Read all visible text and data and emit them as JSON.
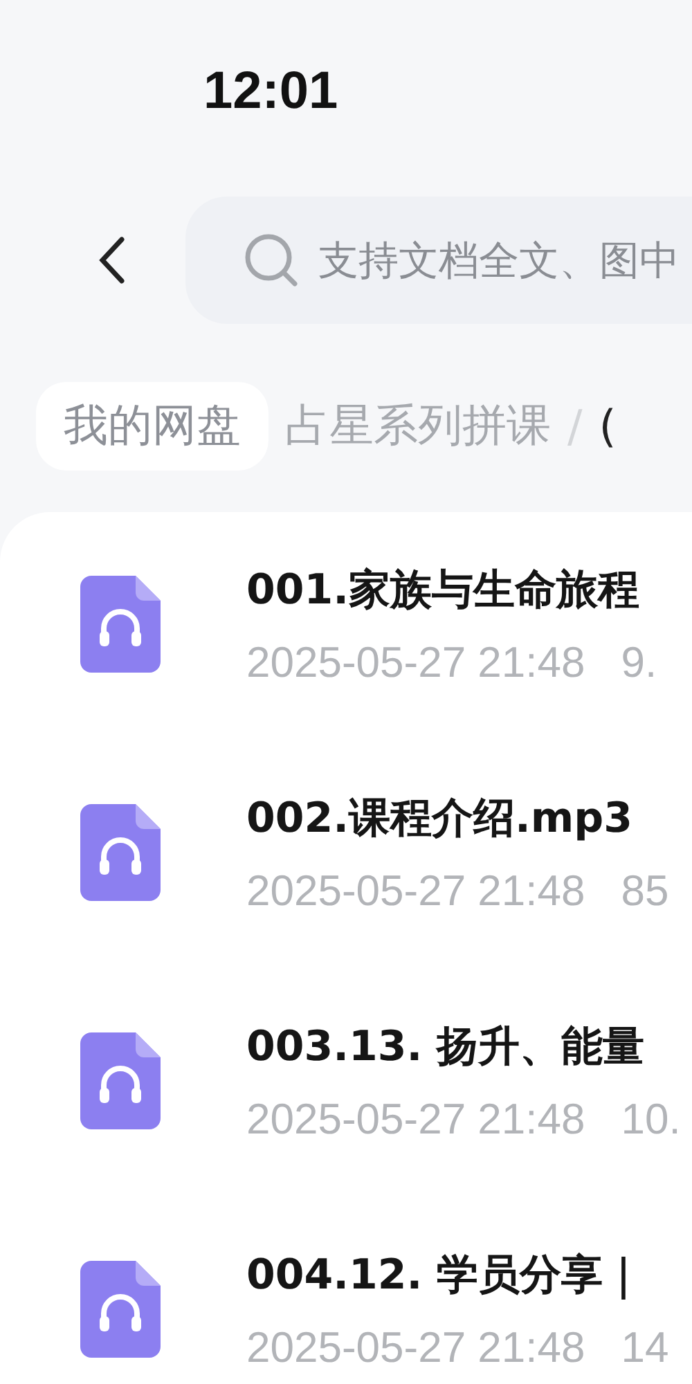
{
  "status_bar": {
    "time": "12:01"
  },
  "search": {
    "placeholder": "支持文档全文、图中"
  },
  "breadcrumbs": [
    {
      "label": "我的网盘",
      "kind": "root"
    },
    {
      "label": "占星系列拼课",
      "kind": "folder"
    },
    {
      "label": "/",
      "kind": "separator"
    },
    {
      "label": "(",
      "kind": "current"
    }
  ],
  "files": [
    {
      "name": "001.家族与生命旅程",
      "date": "2025-05-27 21:48",
      "size": "9."
    },
    {
      "name": "002.课程介绍.mp3",
      "date": "2025-05-27 21:48",
      "size": "85"
    },
    {
      "name": "003.13. 扬升、能量",
      "date": "2025-05-27 21:48",
      "size": "10."
    },
    {
      "name": "004.12. 学员分享｜",
      "date": "2025-05-27 21:48",
      "size": "14"
    }
  ]
}
